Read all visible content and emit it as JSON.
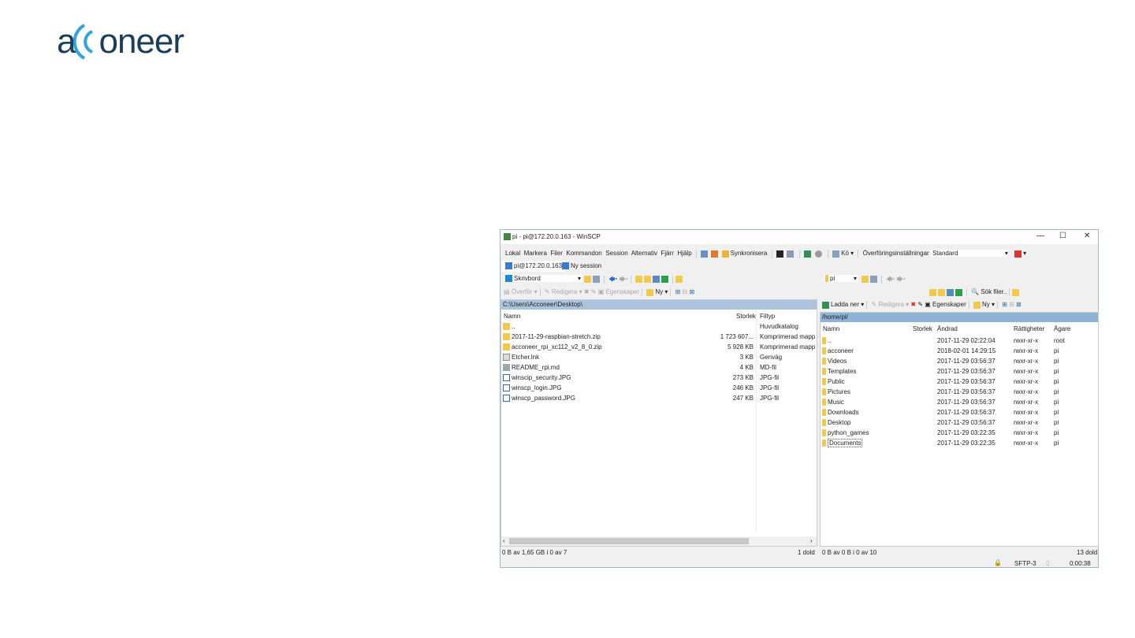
{
  "logo": {
    "text": "acconeer",
    "left": "a",
    "right": "oneer"
  },
  "window": {
    "title": "pi - pi@172.20.0.163 - WinSCP"
  },
  "menu": [
    "Lokal",
    "Markera",
    "Filer",
    "Kommandon",
    "Session",
    "Alternativ",
    "Fjärr",
    "Hjälp"
  ],
  "toolbar": {
    "sync": "Synkronisera",
    "queue": "Kö",
    "transfer_settings": "Överföringsinställningar",
    "transfer_value": "Standard"
  },
  "tabs": [
    "pi@172.20.0.163",
    "Ny session"
  ],
  "left": {
    "drive": "Skrivbord",
    "upload": "Överför",
    "edit": "Redigera",
    "properties": "Egenskaper",
    "new": "Ny",
    "path": "C:\\Users\\Acconeer\\Desktop\\",
    "columns": [
      "Namn",
      "Storlek",
      "Filtyp"
    ],
    "files": [
      {
        "name": "..",
        "size": "",
        "type": "Huvudkatalog"
      },
      {
        "name": "2017-11-29-raspbian-stretch.zip",
        "size": "1 723 607...",
        "type": "Komprimerad mapp"
      },
      {
        "name": "acconeer_rpi_xc112_v2_8_0.zip",
        "size": "5 928 KB",
        "type": "Komprimerad mapp"
      },
      {
        "name": "Etcher.lnk",
        "size": "3 KB",
        "type": "Genväg"
      },
      {
        "name": "README_rpi.md",
        "size": "4 KB",
        "type": "MD-fil"
      },
      {
        "name": "winscip_security.JPG",
        "size": "273 KB",
        "type": "JPG-fil"
      },
      {
        "name": "winscp_login.JPG",
        "size": "246 KB",
        "type": "JPG-fil"
      },
      {
        "name": "winscp_password.JPG",
        "size": "247 KB",
        "type": "JPG-fil"
      }
    ],
    "status": "0 B av 1,65 GB i 0 av 7",
    "hidden": "1 dold"
  },
  "right": {
    "drive": "pi",
    "find": "Sök filer..",
    "download": "Ladda ner",
    "edit": "Redigera",
    "properties": "Egenskaper",
    "new": "Ny",
    "path": "/home/pi/",
    "columns": [
      "Namn",
      "Storlek",
      "Ändrad",
      "Rättigheter",
      "Ägare"
    ],
    "files": [
      {
        "name": "..",
        "changed": "2017-11-29 02:22:04",
        "rights": "rwxr-xr-x",
        "owner": "root"
      },
      {
        "name": "acconeer",
        "changed": "2018-02-01 14:29:15",
        "rights": "rwxr-xr-x",
        "owner": "pi"
      },
      {
        "name": "Videos",
        "changed": "2017-11-29 03:56:37",
        "rights": "rwxr-xr-x",
        "owner": "pi"
      },
      {
        "name": "Templates",
        "changed": "2017-11-29 03:56:37",
        "rights": "rwxr-xr-x",
        "owner": "pi"
      },
      {
        "name": "Public",
        "changed": "2017-11-29 03:56:37",
        "rights": "rwxr-xr-x",
        "owner": "pi"
      },
      {
        "name": "Pictures",
        "changed": "2017-11-29 03:56:37",
        "rights": "rwxr-xr-x",
        "owner": "pi"
      },
      {
        "name": "Music",
        "changed": "2017-11-29 03:56:37",
        "rights": "rwxr-xr-x",
        "owner": "pi"
      },
      {
        "name": "Downloads",
        "changed": "2017-11-29 03:56:37",
        "rights": "rwxr-xr-x",
        "owner": "pi"
      },
      {
        "name": "Desktop",
        "changed": "2017-11-29 03:56:37",
        "rights": "rwxr-xr-x",
        "owner": "pi"
      },
      {
        "name": "python_games",
        "changed": "2017-11-29 03:22:35",
        "rights": "rwxr-xr-x",
        "owner": "pi"
      },
      {
        "name": "Documents",
        "changed": "2017-11-29 03:22:35",
        "rights": "rwxr-xr-x",
        "owner": "pi"
      }
    ],
    "status": "0 B av 0 B i 0 av 10",
    "hidden": "13 dold"
  },
  "statusbar": {
    "protocol": "SFTP-3",
    "time": "0:00:38"
  }
}
